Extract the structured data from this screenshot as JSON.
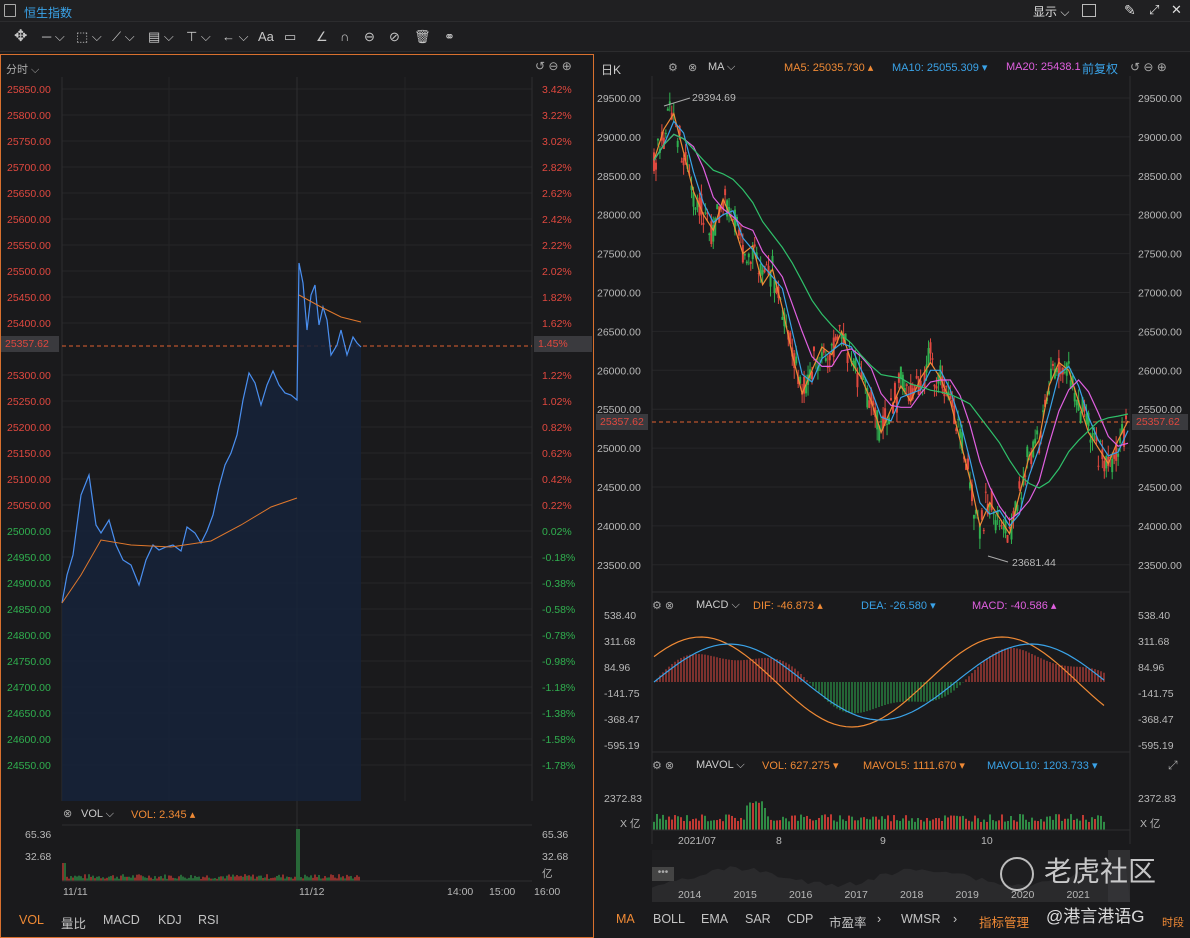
{
  "header": {
    "title": "恒生指数",
    "display_label": "显示"
  },
  "left": {
    "period": "分时",
    "price_ticks": [
      "25850.00",
      "25800.00",
      "25750.00",
      "25700.00",
      "25650.00",
      "25600.00",
      "25550.00",
      "25500.00",
      "25450.00",
      "25400.00",
      "25357.62",
      "25300.00",
      "25250.00",
      "25200.00",
      "25150.00",
      "25100.00",
      "25050.00",
      "25000.00",
      "24950.00",
      "24900.00",
      "24850.00",
      "24800.00",
      "24750.00",
      "24700.00",
      "24650.00",
      "24600.00",
      "24550.00"
    ],
    "pct_ticks": [
      "3.42%",
      "3.22%",
      "3.02%",
      "2.82%",
      "2.62%",
      "2.42%",
      "2.22%",
      "2.02%",
      "1.82%",
      "1.62%",
      "1.45%",
      "1.22%",
      "1.02%",
      "0.82%",
      "0.62%",
      "0.42%",
      "0.22%",
      "0.02%",
      "-0.18%",
      "-0.38%",
      "-0.58%",
      "-0.78%",
      "-0.98%",
      "-1.18%",
      "-1.38%",
      "-1.58%",
      "-1.78%"
    ],
    "vol": {
      "label": "VOL",
      "value": "VOL: 2.345",
      "ticks_left": [
        "65.36",
        "32.68"
      ],
      "ticks_right": [
        "65.36",
        "32.68",
        "亿"
      ]
    },
    "x_ticks": [
      "11/11",
      "11/12",
      "14:00",
      "15:00",
      "16:00"
    ],
    "tabs": [
      "VOL",
      "量比",
      "MACD",
      "KDJ",
      "RSI"
    ]
  },
  "right": {
    "period": "日K",
    "ma": {
      "label": "MA",
      "ma5": "MA5: 25035.730",
      "ma10": "MA10: 25055.309",
      "ma20": "MA20: 25438.1",
      "adjust": "前复权"
    },
    "price_ticks": [
      "29500.00",
      "29000.00",
      "28500.00",
      "28000.00",
      "27500.00",
      "27000.00",
      "26500.00",
      "26000.00",
      "25500.00",
      "25000.00",
      "24500.00",
      "24000.00",
      "23500.00"
    ],
    "current": "25357.62",
    "high_label": "29394.69",
    "low_label": "23681.44",
    "macd": {
      "label": "MACD",
      "dif": "DIF: -46.873",
      "dea": "DEA: -26.580",
      "macd": "MACD: -40.586",
      "ticks": [
        "538.40",
        "311.68",
        "84.96",
        "-141.75",
        "-368.47",
        "-595.19"
      ]
    },
    "mavol": {
      "label": "MAVOL",
      "vol": "VOL: 627.275",
      "mavol5": "MAVOL5: 1111.670",
      "mavol10": "MAVOL10: 1203.733",
      "ticks": [
        "2372.83",
        "X 亿"
      ]
    },
    "months": [
      "2021/07",
      "8",
      "9",
      "10"
    ],
    "years": [
      "2014",
      "2015",
      "2016",
      "2017",
      "2018",
      "2019",
      "2020",
      "2021"
    ],
    "tabs": [
      "MA",
      "BOLL",
      "EMA",
      "SAR",
      "CDP",
      "市盈率",
      "WMSR",
      "指标管理",
      "时段"
    ]
  },
  "watermark": {
    "brand": "老虎社区",
    "user": "@港言港语G"
  }
}
